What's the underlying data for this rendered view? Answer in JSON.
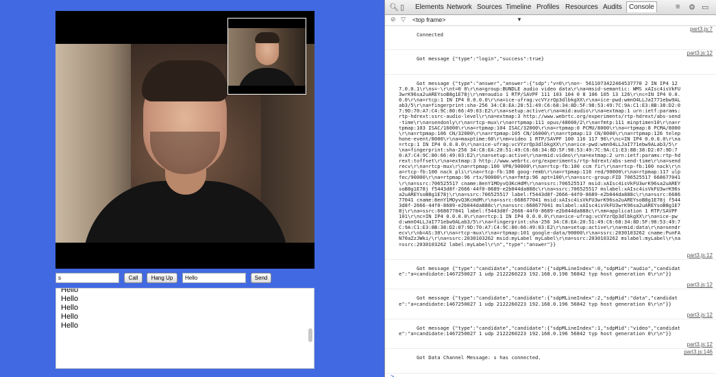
{
  "app": {
    "name_input_value": "s",
    "call_label": "Call",
    "hangup_label": "Hang Up",
    "message_input_value": "Hello",
    "send_label": "Send",
    "chat_lines": [
      "Hello",
      "Hello",
      "Hello",
      "Hello",
      "Hello"
    ]
  },
  "devtools": {
    "tabs": [
      "Elements",
      "Network",
      "Sources",
      "Timeline",
      "Profiles",
      "Resources",
      "Audits",
      "Console"
    ],
    "active_tab": "Console",
    "frame_selector": "<top frame>",
    "messages": [
      {
        "text": "Connected",
        "source": "part3.js:7"
      },
      {
        "text": "Got message {\"type\":\"login\",\"success\":true}",
        "source": "part3.js:12"
      },
      {
        "text": "Got message {\"type\":\"answer\",\"answer\":{\"sdp\":\"v=0\\r\\no=- 5611073422464537770 2 IN IP4 127.0.0.1\\r\\ns=-\\r\\nt=0 0\\r\\na=group:BUNDLE audio video data\\r\\na=msid-semantic: WMS xAIsc4isVkFU3wrK96sa2uAREYsoB8g1E78j\\r\\nm=audio 1 RTP/SAVPF 111 103 104 0 8 106 105 13 126\\r\\nc=IN IP4 0.0.0.0\\r\\na=rtcp:1 IN IP4 0.0.0.0\\r\\na=ice-ufrag:vcVYzrQp3dlbkgXX\\r\\na=ice-pwd:wmnO4LLJaI771ebw9ALab3/5\\r\\na=fingerprint:sha-256 34:C8:EA:20:51:49:C6:68:34:8D:5F:98:53:49:7C:9A:C1:E3:8B:38:D2:07:9D:70:A7:C4:9C:80:66:49:03:E2\\r\\na=setup:active\\r\\na=mid:audio\\r\\na=extmap:1 urn:ietf:params:rtp-hdrext:ssrc-audio-level\\r\\na=extmap:3 http://www.webrtc.org/experiments/rtp-hdrext/abs-send-time\\r\\na=sendonly\\r\\na=rtcp-mux\\r\\na=rtpmap:111 opus/48000/2\\r\\na=fmtp:111 minptime=10\\r\\na=rtpmap:103 ISAC/16000\\r\\na=rtpmap:104 ISAC/32000\\r\\na=rtpmap:0 PCMU/8000\\r\\na=rtpmap:8 PCMA/8000\\r\\na=rtpmap:106 CN/32000\\r\\na=rtpmap:105 CN/16000\\r\\na=rtpmap:13 CN/8000\\r\\na=rtpmap:126 telephone-event/8000\\r\\na=maxptime:60\\r\\nm=video 1 RTP/SAVPF 100 116 117 96\\r\\nc=IN IP4 0.0.0.0\\r\\na=rtcp:1 IN IP4 0.0.0.0\\r\\na=ice-ufrag:vcVYzrQp3dlbkgXX\\r\\na=ice-pwd:wmnO4LLJaI771ebw9ALab3/5\\r\\na=fingerprint:sha-256 34:C8:EA:20:51:49:C6:68:34:8D:5F:98:53:49:7C:9A:C1:E3:8B:38:D2:07:9D:70:A7:C4:9C:80:66:49:03:E2\\r\\na=setup:active\\r\\na=mid:video\\r\\na=extmap:2 urn:ietf:params:rtp-hdrext:toffset\\r\\na=extmap:3 http://www.webrtc.org/experiments/rtp-hdrext/abs-send-time\\r\\na=sendrecv\\r\\na=rtcp-mux\\r\\na=rtpmap:100 VP8/90000\\r\\na=rtcp-fb:100 ccm fir\\r\\na=rtcp-fb:100 nack\\r\\na=rtcp-fb:100 nack pli\\r\\na=rtcp-fb:100 goog-remb\\r\\na=rtpmap:116 red/90000\\r\\na=rtpmap:117 ulpfec/90000\\r\\na=rtpmap:96 rtx/90000\\r\\na=fmtp:96 apt=100\\r\\na=ssrc-group:FID 706525517 668677041\\r\\na=ssrc:706525517 cname:8enY1MOyvQ3KcHdM\\r\\na=ssrc:706525517 msid:xAIsc4isVkFU3wrK96sa2uAREYsoB8g1E78j f5443d8f-2666-44f0-8689-e2b044da888c\\r\\na=ssrc:706525517 mslabel:xAIsc4isVkFU3wrK96sa2uAREYsoB8g1E78j\\r\\na=ssrc:706525517 label:f5443d8f-2666-44f0-8689-e2b044da888c\\r\\na=ssrc:668677041 cname:8enY1MOyvQ3KcHdM\\r\\na=ssrc:668677041 msid:xAIsc4isVkFU3wrK96sa2uAREYsoB8g1E78j f5443d8f-2666-44f0-8689-e2b044da888c\\r\\na=ssrc:668677041 mslabel:xAIsc4isVkFU3wrK96sa2uAREYsoB8g1E78j\\r\\na=ssrc:668677041 label:f5443d8f-2666-44f0-8689-e2b044da888c\\r\\nm=application 1 RTP/SAVPF 101\\r\\nc=IN IP4 0.0.0.0\\r\\na=rtcp:1 IN IP4 0.0.0.0\\r\\na=ice-ufrag:vcVYzrQp3dlbkgXX\\r\\na=ice-pwd:wmnO4LLJaI771ebw9ALab3/5\\r\\na=fingerprint:sha-256 34:C8:EA:20:51:49:C6:68:34:8D:5F:98:53:49:7C:9A:C1:E3:8B:38:D2:07:9D:70:A7:C4:9C:80:66:49:03:E2\\r\\na=setup:active\\r\\na=mid:data\\r\\na=sendrecv\\r\\nb=AS:30\\r\\na=rtcp-mux\\r\\na=rtpmap:101 google-data/90000\\r\\na=ssrc:2030103262 cname:PunFAN70aZzJWki/\\r\\na=ssrc:2030103262 msid:myLabel myLabel\\r\\na=ssrc:2030103262 mslabel:myLabel\\r\\na=ssrc:2030103262 label:myLabel\\r\\n\",\"type\":\"answer\"}}",
        "source": "part3.js:12"
      },
      {
        "text": "Got message {\"type\":\"candidate\",\"candidate\":{\"sdpMLineIndex\":0,\"sdpMid\":\"audio\",\"candidate\":\"a=candidate:1467250027 1 udp 2122260223 192.168.0.196 56842 typ host generation 0\\r\\n\"}}",
        "source": "part3.js:12"
      },
      {
        "text": "Got message {\"type\":\"candidate\",\"candidate\":{\"sdpMLineIndex\":2,\"sdpMid\":\"data\",\"candidate\":\"a=candidate:1467250027 1 udp 2122260223 192.168.0.196 56842 typ host generation 0\\r\\n\"}}",
        "source": "part3.js:12"
      },
      {
        "text": "Got message {\"type\":\"candidate\",\"candidate\":{\"sdpMLineIndex\":1,\"sdpMid\":\"video\",\"candidate\":\"a=candidate:1467250027 1 udp 2122260223 192.168.0.196 56842 typ host generation 0\\r\\n\"}}",
        "source": "part3.js:12"
      },
      {
        "text": "Got Data Channel Message: s has connected.",
        "source": "part3.js:146"
      }
    ],
    "prompt_symbol": ">"
  }
}
